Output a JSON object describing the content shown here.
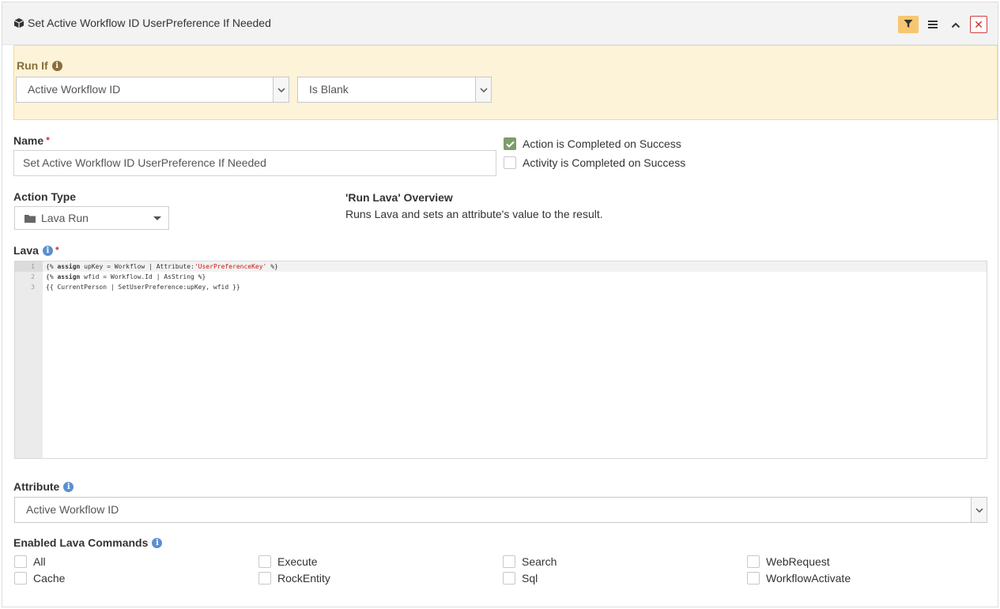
{
  "header": {
    "title": "Set Active Workflow ID UserPreference If Needed",
    "close_glyph": "✕"
  },
  "run_if": {
    "label": "Run If",
    "info_glyph": "i",
    "attribute_value": "Active Workflow ID",
    "comparison_value": "Is Blank"
  },
  "name": {
    "label": "Name",
    "required_mark": "•",
    "value": "Set Active Workflow ID UserPreference If Needed"
  },
  "options": {
    "action_completed": "Action is Completed on Success",
    "activity_completed": "Activity is Completed on Success"
  },
  "action_type": {
    "label": "Action Type",
    "value": "Lava Run"
  },
  "overview": {
    "title": "'Run Lava' Overview",
    "text": "Runs Lava and sets an attribute's value to the result."
  },
  "lava": {
    "label": "Lava",
    "info_glyph": "i",
    "required_mark": "•",
    "line_numbers": [
      "1",
      "2",
      "3"
    ],
    "line1_a": "{% ",
    "line1_b": "assign",
    "line1_c": " upKey = Workflow | Attribute:",
    "line1_d": "'UserPreferenceKey'",
    "line1_e": " %}",
    "line2_a": "{% ",
    "line2_b": "assign",
    "line2_c": " wfid = Workflow.Id | AsString %}",
    "line3": "{{ CurrentPerson | SetUserPreference:upKey, wfid }}"
  },
  "attribute": {
    "label": "Attribute",
    "info_glyph": "i",
    "value": "Active Workflow ID"
  },
  "lava_commands": {
    "label": "Enabled Lava Commands",
    "info_glyph": "i",
    "items": [
      "All",
      "Execute",
      "Search",
      "WebRequest",
      "Cache",
      "RockEntity",
      "Sql",
      "WorkflowActivate"
    ]
  }
}
